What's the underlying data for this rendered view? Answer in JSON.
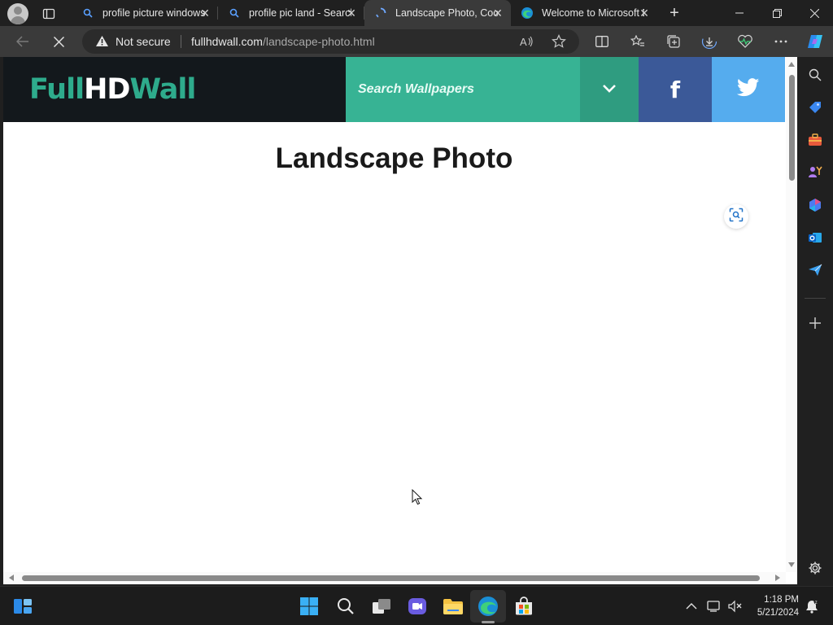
{
  "browser": {
    "tabs": [
      {
        "title": "profile picture windows",
        "favicon": "search-icon"
      },
      {
        "title": "profile pic land - Search",
        "favicon": "search-icon"
      },
      {
        "title": "Landscape Photo, Cool",
        "favicon": "loading-icon",
        "active": true
      },
      {
        "title": "Welcome to Microsoft Edge",
        "favicon": "edge-icon"
      }
    ],
    "security_label": "Not secure",
    "url_domain": "fullhdwall.com",
    "url_path": "/landscape-photo.html"
  },
  "site": {
    "logo_part1": "Full",
    "logo_part2": "HD",
    "logo_part3": "Wall",
    "search_placeholder": "Search Wallpapers",
    "facebook_label": "f",
    "page_title": "Landscape Photo"
  },
  "taskbar": {
    "time": "1:18 PM",
    "date": "5/21/2024"
  },
  "colors": {
    "logo_green": "#2eab8c",
    "search_teal": "#37b394",
    "dropdown_teal": "#2f9c80",
    "facebook_blue": "#3b5998",
    "twitter_blue": "#55acee",
    "header_dark": "#13181c"
  }
}
